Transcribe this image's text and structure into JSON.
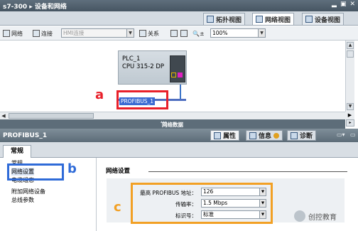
{
  "window": {
    "title": "s7-300 ▸ 设备和网络",
    "min": "▂",
    "restore": "▣",
    "close": "✕"
  },
  "view_tabs": [
    {
      "label": "拓扑视图"
    },
    {
      "label": "网络视图"
    },
    {
      "label": "设备视图"
    }
  ],
  "toolbar": {
    "network_label": "网络",
    "connect_label": "连接",
    "connection_type_placeholder": "HMI连接",
    "relation_label": "关系",
    "zoom_value": "100%"
  },
  "canvas": {
    "plc_name": "PLC_1",
    "plc_type": "CPU 315-2 DP",
    "bus_label": "PROFIBUS_1",
    "annotation_a": "a"
  },
  "network_data_label": "网络数据",
  "properties": {
    "title": "PROFIBUS_1",
    "tab_properties": "属性",
    "tab_info": "信息",
    "tab_diagnostics": "诊断",
    "general_tab": "常规",
    "nav": [
      "常规",
      "网络设置",
      "电缆组态",
      "附加网络设备",
      "总线参数"
    ],
    "annotation_b": "b",
    "annotation_c": "c",
    "section_title": "网络设置",
    "fields": [
      {
        "label": "最高 PROFIBUS 地址：",
        "value": "126"
      },
      {
        "label": "传输率：",
        "value": "1.5 Mbps"
      },
      {
        "label": "标识号：",
        "value": "标准"
      }
    ]
  },
  "watermark": "创控教育",
  "colors": {
    "highlight_red": "#e8202a",
    "highlight_blue": "#2f6bd8",
    "highlight_orange": "#f2a024",
    "bus_blue": "#3a6ad2"
  }
}
